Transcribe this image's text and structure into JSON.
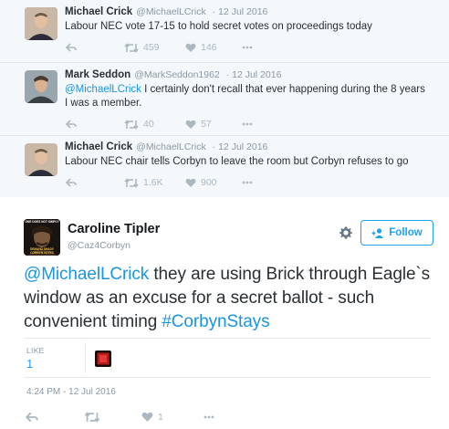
{
  "conversation": [
    {
      "name": "Michael Crick",
      "handle": "@MichaelLCrick",
      "date": "12 Jul 2016",
      "text": "Labour NEC vote 17-15 to hold secret votes on proceedings today",
      "mention": "",
      "retweets": "459",
      "likes": "146"
    },
    {
      "name": "Mark Seddon",
      "handle": "@MarkSeddon1962",
      "date": "12 Jul 2016",
      "mention": "@MichaelLCrick",
      "text": " I certainly don't recall that ever happening during the 8 years I was a member.",
      "retweets": "40",
      "likes": "57"
    },
    {
      "name": "Michael Crick",
      "handle": "@MichaelLCrick",
      "date": "12 Jul 2016",
      "text": "Labour NEC chair tells Corbyn to leave the room but Corbyn refuses to go",
      "mention": "",
      "retweets": "1.6K",
      "likes": "900"
    }
  ],
  "main_tweet": {
    "name": "Caroline Tipler",
    "handle": "@Caz4Corbyn",
    "avatar_text_top": "ONE DOES NOT SIMPLY",
    "avatar_text_bottom": "DEMAND SHADY CORBYN VOTES",
    "follow_label": "Follow",
    "mention": "@MichaelLCrick",
    "text_body": " they are using Brick through Eagle`s window as an excuse for a secret ballot - such convenient timing ",
    "hashtag": "#CorbynStays",
    "likes_label": "LIKE",
    "likes_count": "1",
    "timestamp": "4:24 PM - 12 Jul 2016",
    "like_count_action": "1"
  },
  "colors": {
    "link": "#1b95e0",
    "accent": "#1da1f2",
    "muted": "#8899a6",
    "icon": "#aab8c2",
    "context_bg": "#f5f8fa"
  },
  "icons": [
    "reply-icon",
    "retweet-icon",
    "heart-icon",
    "more-icon",
    "gear-icon",
    "follow-user-icon"
  ]
}
